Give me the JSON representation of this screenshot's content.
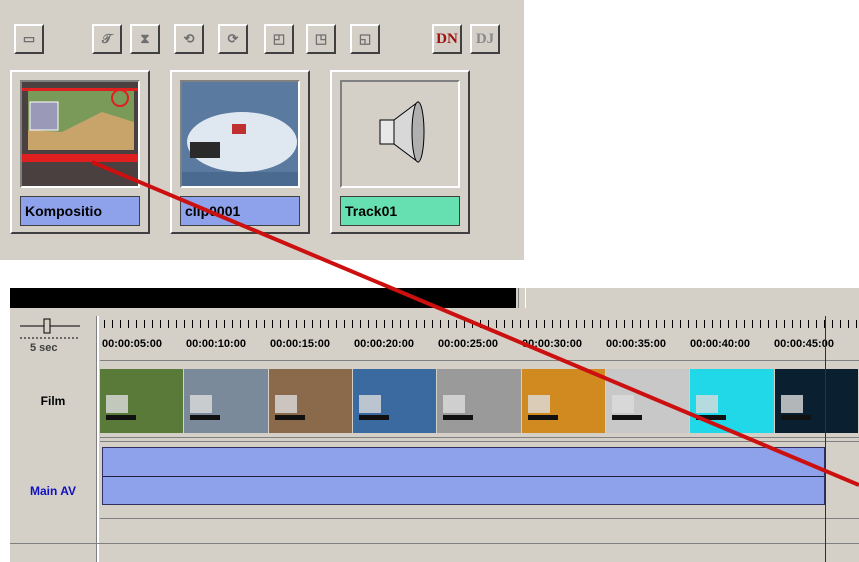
{
  "toolbar": {
    "buttons": [
      {
        "name": "window-icon",
        "glyph": "▭"
      },
      {
        "name": "text-tool-icon",
        "glyph": "𝒯"
      },
      {
        "name": "hourglass-icon",
        "glyph": "⧗"
      },
      {
        "name": "rotate-left-icon",
        "glyph": "⟲"
      },
      {
        "name": "rotate-right-icon",
        "glyph": "⟳"
      },
      {
        "name": "box-a-icon",
        "glyph": "◰"
      },
      {
        "name": "box-b-icon",
        "glyph": "◳"
      },
      {
        "name": "box-c-icon",
        "glyph": "◱"
      }
    ],
    "dn_label": "DN",
    "dj_label": "DJ"
  },
  "bin": {
    "clips": [
      {
        "label": "Kompositio",
        "label_color": "#8ea2ec"
      },
      {
        "label": "clip0001",
        "label_color": "#8ea2ec"
      },
      {
        "label": "Track01",
        "label_color": "#66e0b0"
      }
    ]
  },
  "timeline": {
    "zoom_label": "5 sec",
    "timecodes": [
      "00:00:05:00",
      "00:00:10:00",
      "00:00:15:00",
      "00:00:20:00",
      "00:00:25:00",
      "00:00:30:00",
      "00:00:35:00",
      "00:00:40:00",
      "00:00:45:00"
    ],
    "tracks": [
      {
        "label": "Film",
        "color": "#000000"
      },
      {
        "label": "Main AV",
        "color": "#1010c0"
      }
    ],
    "frame_colors": [
      "#5a7a3a",
      "#7a8a9a",
      "#8a6a4a",
      "#3a6aa0",
      "#9a9a9a",
      "#d08a20",
      "#c8c8c8",
      "#20d8e8",
      "#0a2030"
    ]
  },
  "annotation": {
    "arrow_color": "#cc1010"
  }
}
